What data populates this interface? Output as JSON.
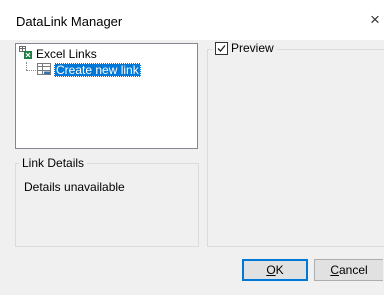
{
  "window": {
    "title": "DataLink Manager",
    "close_glyph": "×"
  },
  "tree": {
    "root_label": "Excel Links",
    "root_icon": "excel-links-icon",
    "child_label": "Create new link",
    "child_icon": "table-link-icon",
    "selected": "Create new link"
  },
  "link_details": {
    "caption": "Link Details",
    "text": "Details unavailable"
  },
  "preview": {
    "caption": "Preview",
    "checked": true
  },
  "buttons": {
    "ok_mnemonic": "O",
    "ok_rest": "K",
    "cancel_mnemonic": "C",
    "cancel_rest": "ancel"
  },
  "colors": {
    "selection": "#0078d7",
    "dialog_bg": "#f0f0f0"
  }
}
